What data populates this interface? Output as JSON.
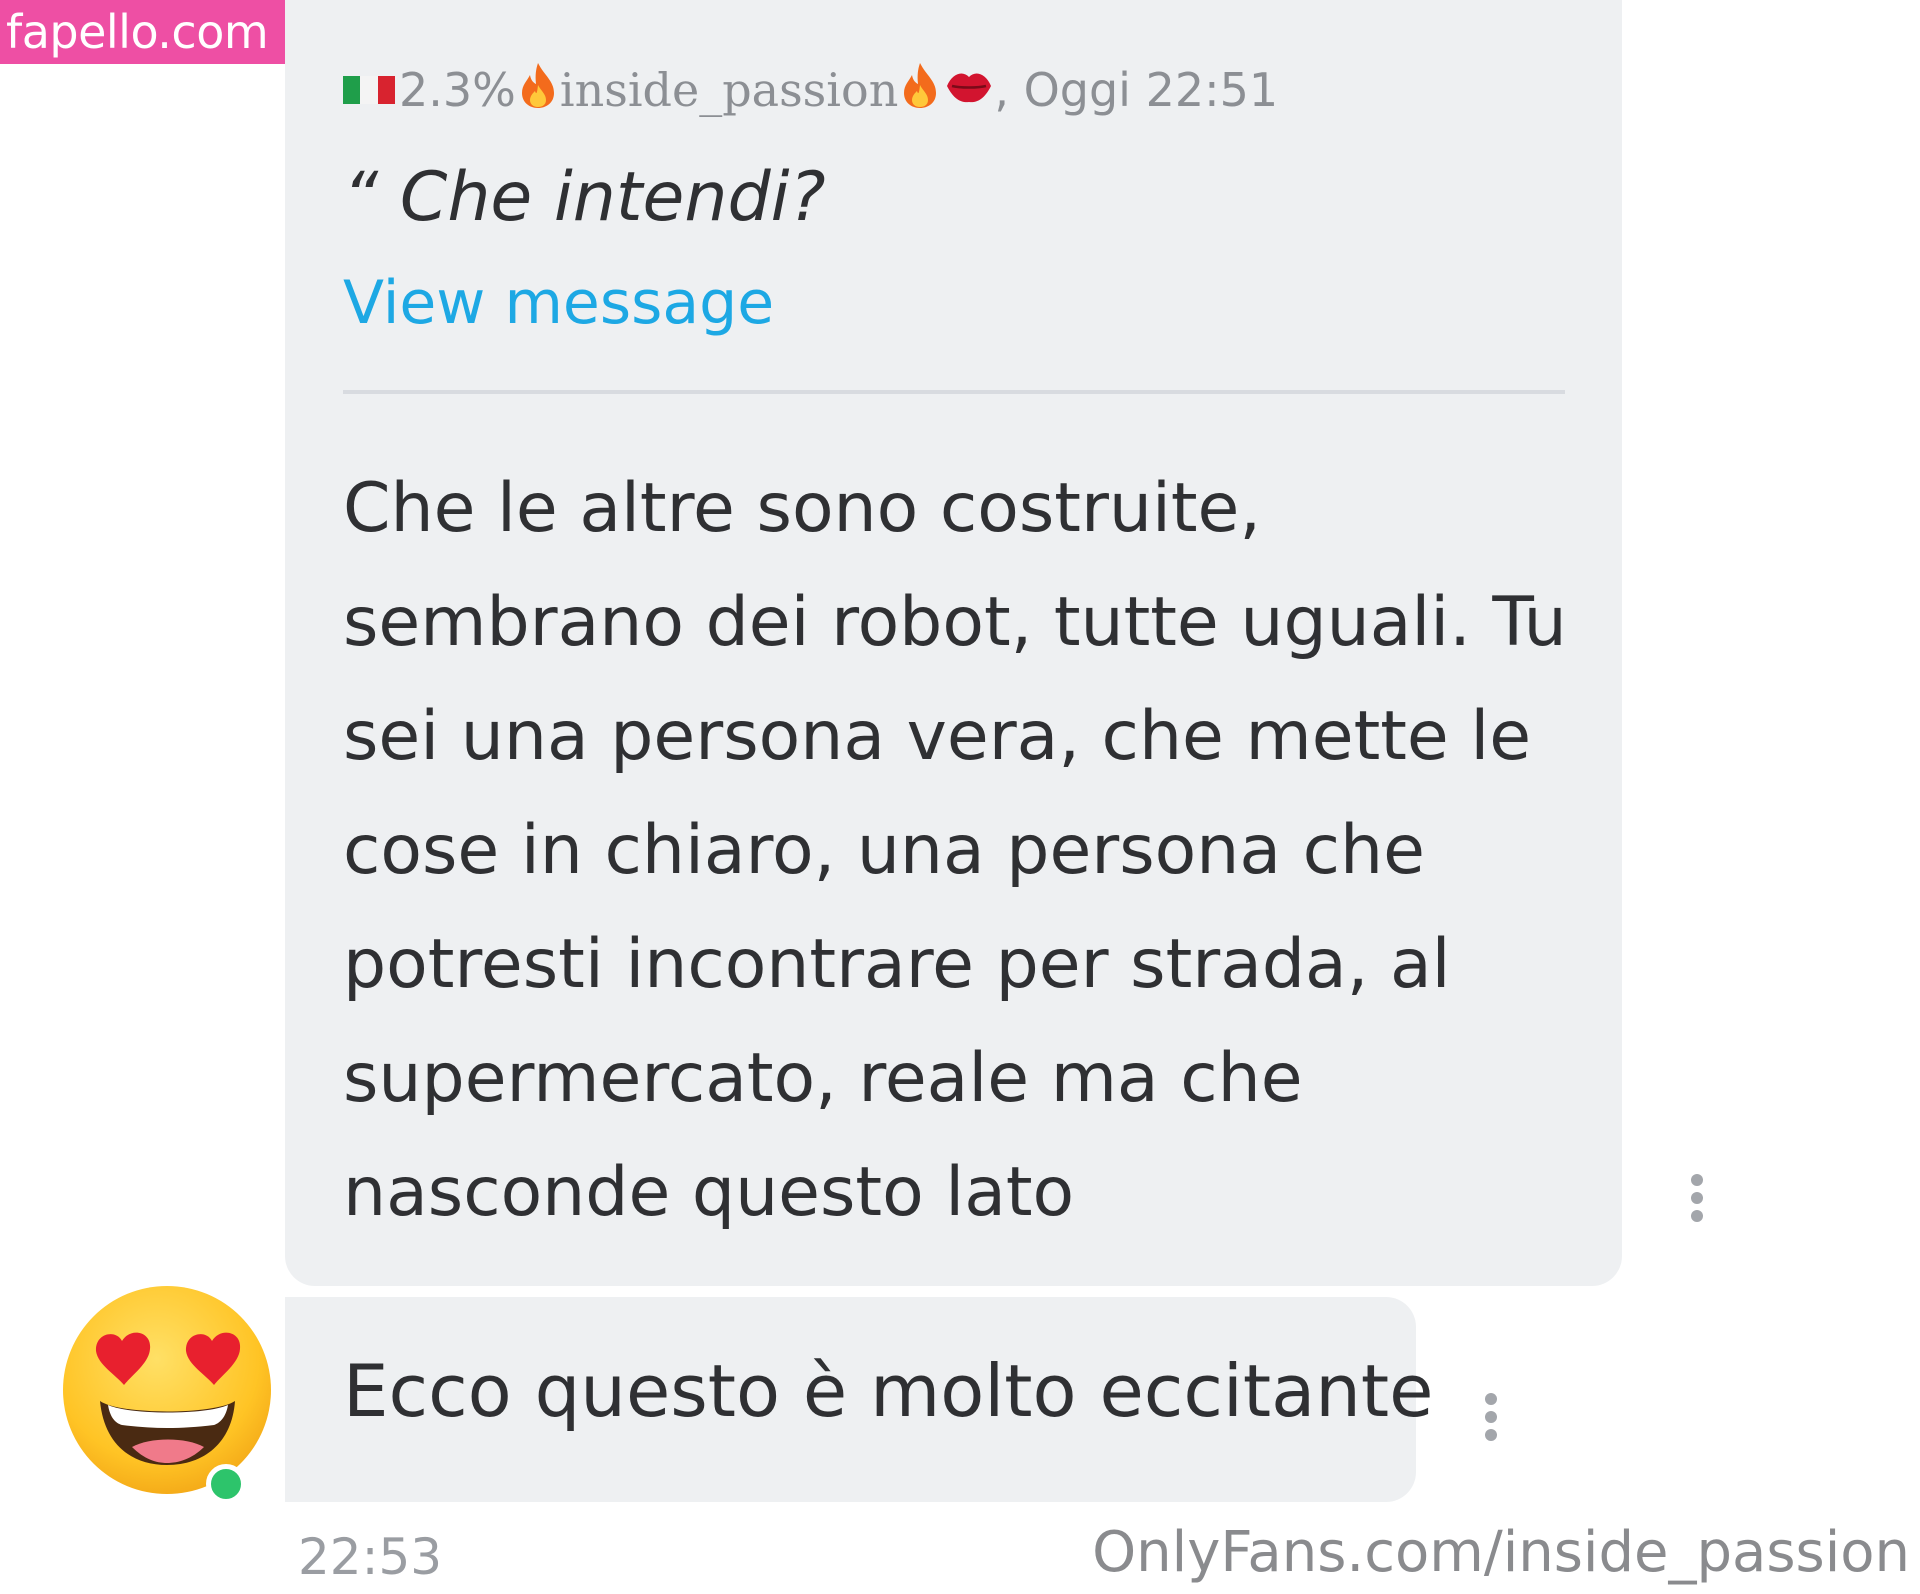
{
  "watermarks": {
    "top": "fapello.com",
    "bottom": "OnlyFans.com/inside_passion"
  },
  "quoted": {
    "flag_icon": "italy-flag-icon",
    "percent": "2.3%",
    "fire_icon": "fire-emoji-icon",
    "username": "inside_passion",
    "lips_icon": "kiss-mark-emoji-icon",
    "date_time": ", Oggi 22:51",
    "text": "“ Che intendi?",
    "view_link": "View message"
  },
  "message": {
    "lines": [
      "Che le altre sono costruite,",
      "sembrano dei robot, tutte uguali. Tu",
      "sei una persona vera, che mette le",
      "cose in chiaro, una persona che",
      "potresti incontrare per strada, al",
      "supermercato, reale ma che",
      "nasconde questo lato"
    ]
  },
  "reply": {
    "text": "Ecco questo è molto eccitante",
    "avatar_icon": "heart-eyes-emoji-icon",
    "time": "22:53"
  },
  "colors": {
    "bubble": "#eef0f2",
    "link": "#1da8e4",
    "watermark_pink": "#ee4fa4",
    "online": "#2dc46b"
  }
}
